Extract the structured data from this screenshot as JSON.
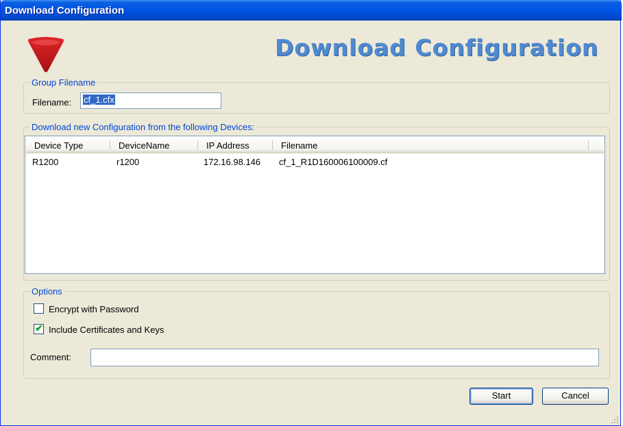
{
  "window": {
    "title": "Download Configuration",
    "banner": "Download Configuration"
  },
  "group_filename": {
    "legend": "Group Filename",
    "filename_label": "Filename:",
    "filename_value": "cf_1.cfx"
  },
  "devices": {
    "legend": "Download new Configuration from the following Devices:",
    "columns": [
      "Device Type",
      "DeviceName",
      "IP Address",
      "Filename"
    ],
    "rows": [
      [
        "R1200",
        "r1200",
        "172.16.98.146",
        "cf_1_R1D160006100009.cf"
      ]
    ]
  },
  "options": {
    "legend": "Options",
    "encrypt_label": "Encrypt with Password",
    "encrypt_checked": false,
    "include_certs_label": "Include Certificates and Keys",
    "include_certs_checked": true,
    "comment_label": "Comment:",
    "comment_value": ""
  },
  "buttons": {
    "start": "Start",
    "cancel": "Cancel"
  },
  "colors": {
    "titlebar": "#0054e3",
    "banner_text": "#4f8ad0",
    "legend_text": "#0046d5",
    "logo": "#c0171a",
    "dialog_bg": "#ece9d8"
  },
  "icons": {
    "logo": "red-down-triangle-logo",
    "grip": "resize-grip-icon"
  }
}
